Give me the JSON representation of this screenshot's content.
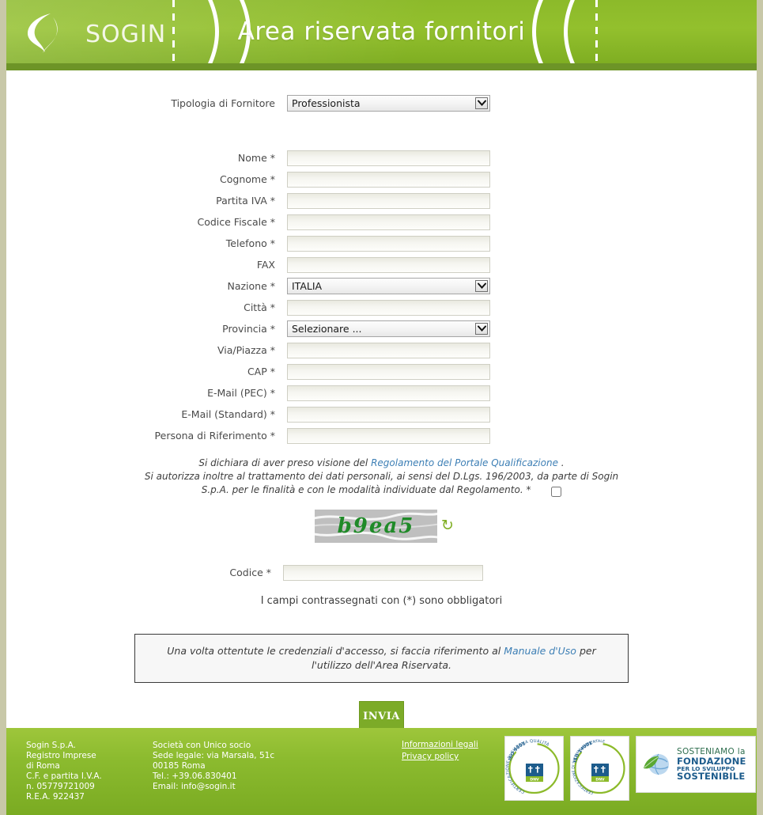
{
  "header": {
    "logo_text": "SOGIN",
    "title": "Area riservata fornitori"
  },
  "form": {
    "supplier_type": {
      "label": "Tipologia di Fornitore",
      "value": "Professionista"
    },
    "fields": [
      {
        "label": "Nome *",
        "type": "text",
        "value": "",
        "name": "nome"
      },
      {
        "label": "Cognome *",
        "type": "text",
        "value": "",
        "name": "cognome"
      },
      {
        "label": "Partita IVA *",
        "type": "text",
        "value": "",
        "name": "partita-iva"
      },
      {
        "label": "Codice Fiscale *",
        "type": "text",
        "value": "",
        "name": "codice-fiscale"
      },
      {
        "label": "Telefono *",
        "type": "text",
        "value": "",
        "name": "telefono"
      },
      {
        "label": "FAX",
        "type": "text",
        "value": "",
        "name": "fax"
      },
      {
        "label": "Nazione *",
        "type": "select",
        "value": "ITALIA",
        "name": "nazione"
      },
      {
        "label": "Città *",
        "type": "text",
        "value": "",
        "name": "citta"
      },
      {
        "label": "Provincia *",
        "type": "select",
        "value": "Selezionare ...",
        "name": "provincia"
      },
      {
        "label": "Via/Piazza *",
        "type": "text",
        "value": "",
        "name": "via-piazza"
      },
      {
        "label": "CAP *",
        "type": "text",
        "value": "",
        "name": "cap"
      },
      {
        "label": "E-Mail (PEC) *",
        "type": "text",
        "value": "",
        "name": "email-pec"
      },
      {
        "label": "E-Mail (Standard) *",
        "type": "text",
        "value": "",
        "name": "email-standard"
      },
      {
        "label": "Persona di Riferimento *",
        "type": "text",
        "value": "",
        "name": "persona-riferimento"
      }
    ],
    "legal": {
      "line1_before": "Si dichiara di aver preso visione del ",
      "line1_link": "Regolamento del Portale Qualificazione",
      "line1_after": " .",
      "line2": "Si autorizza inoltre al trattamento dei dati personali, ai sensi del D.Lgs. 196/2003, da parte di Sogin",
      "line3": "S.p.A. per le finalità e con le modalità individuate dal Regolamento. *",
      "checkbox_checked": false
    },
    "captcha": {
      "text": "b9ea5",
      "refresh_icon": "refresh-icon",
      "code_label": "Codice *",
      "code_value": ""
    },
    "required_note": "I campi contrassegnati con (*) sono obbligatori",
    "infobox": {
      "before": "Una volta ottentute le credenziali d'accesso, si faccia riferimento al ",
      "link": "Manuale d'Uso",
      "after": " per l'utilizzo dell'Area Riservata."
    },
    "submit_label": "INVIA"
  },
  "footer": {
    "col1": "Sogin S.p.A.\nRegistro Imprese\ndi Roma\nC.F. e partita I.V.A.\nn. 05779721009\nR.E.A. 922437",
    "col2": "Società con Unico socio\nSede legale: via Marsala, 51c\n00185 Roma\nTel.: +39.06.830401\nEmail: info@sogin.it",
    "links": [
      {
        "label": "Informazioni legali"
      },
      {
        "label": "Privacy policy"
      }
    ],
    "badges": [
      {
        "name": "iso-9001-badge",
        "ring_text": "CERTIFICAZIONE DI SISTEMA QUALITÀ",
        "standard": "ISO 9001",
        "mark": "DNV"
      },
      {
        "name": "iso-14001-badge",
        "ring_text": "CERTIFICAZIONE DI SISTEMA AMBIENTALE",
        "standard": "ISO 14001",
        "mark": "DNV"
      },
      {
        "name": "fondazione-sviluppo-sostenibile-badge",
        "line1": "SOSTENIAMO la",
        "line2": "FONDAZIONE",
        "line3": "PER LO SVILUPPO",
        "line4": "SOSTENIBILE"
      }
    ]
  },
  "colors": {
    "brand_green": "#8cba2a",
    "header_bar": "#6d9427",
    "link_blue": "#3d7fb5",
    "captcha_green": "#1f8a28",
    "page_border": "#c8c8a8"
  }
}
